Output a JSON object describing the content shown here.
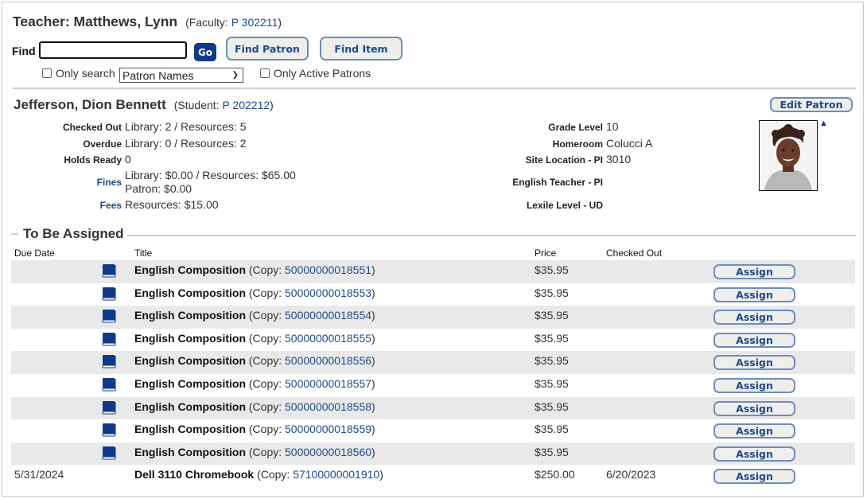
{
  "teacher": {
    "name": "Teacher: Matthews, Lynn",
    "sub_prefix": "(Faculty: ",
    "id_link": "P 302211",
    "sub_suffix": ")"
  },
  "find": {
    "label": "Find",
    "value": "",
    "placeholder": "",
    "go_label": "Go",
    "find_patron_label": "Find Patron",
    "find_item_label": "Find Item",
    "only_search_label": "Only search",
    "only_search_checked": false,
    "select_value": "Patron Names",
    "only_active_label": "Only Active Patrons",
    "only_active_checked": false
  },
  "student": {
    "name": "Jefferson, Dion Bennett",
    "sub_prefix": "(Student: ",
    "id_link": "P 202212",
    "sub_suffix": ")",
    "edit_label": "Edit Patron",
    "left_fields": [
      {
        "label": "Checked Out",
        "value": "Library: 2 / Resources: 5",
        "is_link": false
      },
      {
        "label": "Overdue",
        "value": "Library: 0 / Resources: 2",
        "is_link": false
      },
      {
        "label": "Holds Ready",
        "value": "0",
        "is_link": false
      },
      {
        "label": "Fines",
        "value": "Library: $0.00 / Resources: $65.00",
        "value2": "Patron: $0.00",
        "is_link": true
      },
      {
        "label": "Fees",
        "value": "Resources: $15.00",
        "is_link": true
      }
    ],
    "right_fields": [
      {
        "label": "Grade Level",
        "value": "10"
      },
      {
        "label": "Homeroom",
        "value": "Colucci A"
      },
      {
        "label": "Site Location - PI",
        "value": "3010"
      },
      {
        "label": "English Teacher - PI",
        "value": ""
      },
      {
        "label": "Lexile Level - UD",
        "value": ""
      }
    ],
    "photo_icon": "student-photo",
    "collapse_icon": "triangle-up-icon"
  },
  "assign_section": {
    "title": "To Be Assigned",
    "columns": [
      "Due Date",
      "Title",
      "Price",
      "Checked Out"
    ],
    "copy_prefix": "(Copy: ",
    "copy_suffix": ")",
    "assign_label": "Assign",
    "rows": [
      {
        "due_date": "",
        "icon": "book-icon",
        "title": "English Composition",
        "copy": "50000000018551",
        "price": "$35.95",
        "checked_out": ""
      },
      {
        "due_date": "",
        "icon": "book-icon",
        "title": "English Composition",
        "copy": "50000000018553",
        "price": "$35.95",
        "checked_out": ""
      },
      {
        "due_date": "",
        "icon": "book-icon",
        "title": "English Composition",
        "copy": "50000000018554",
        "price": "$35.95",
        "checked_out": ""
      },
      {
        "due_date": "",
        "icon": "book-icon",
        "title": "English Composition",
        "copy": "50000000018555",
        "price": "$35.95",
        "checked_out": ""
      },
      {
        "due_date": "",
        "icon": "book-icon",
        "title": "English Composition",
        "copy": "50000000018556",
        "price": "$35.95",
        "checked_out": ""
      },
      {
        "due_date": "",
        "icon": "book-icon",
        "title": "English Composition",
        "copy": "50000000018557",
        "price": "$35.95",
        "checked_out": ""
      },
      {
        "due_date": "",
        "icon": "book-icon",
        "title": "English Composition",
        "copy": "50000000018558",
        "price": "$35.95",
        "checked_out": ""
      },
      {
        "due_date": "",
        "icon": "book-icon",
        "title": "English Composition",
        "copy": "50000000018559",
        "price": "$35.95",
        "checked_out": ""
      },
      {
        "due_date": "",
        "icon": "book-icon",
        "title": "English Composition",
        "copy": "50000000018560",
        "price": "$35.95",
        "checked_out": ""
      },
      {
        "due_date": "5/31/2024",
        "icon": "",
        "title": "Dell 3110 Chromebook",
        "copy": "57100000001910",
        "price": "$250.00",
        "checked_out": "6/20/2023"
      }
    ]
  },
  "colors": {
    "link": "#1a4b8f",
    "button_border": "#6c8dc0",
    "button_text": "#1c4a90",
    "go_bg": "#0d3a8c",
    "row_shade": "#e9e9e9",
    "book_icon": "#0d3a8c"
  }
}
